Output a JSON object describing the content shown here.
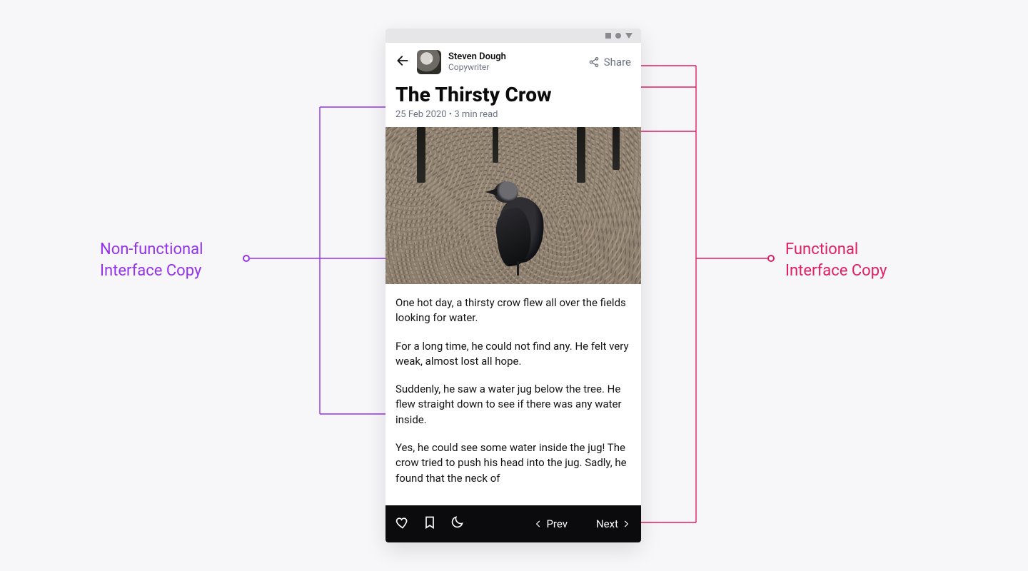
{
  "annotations": {
    "left": {
      "line1": "Non-functional",
      "line2": "Interface Copy"
    },
    "right": {
      "line1": "Functional",
      "line2": "Interface Copy"
    }
  },
  "header": {
    "author_name": "Steven Dough",
    "author_role": "Copywriter",
    "share_label": "Share"
  },
  "article": {
    "title": "The Thirsty Crow",
    "date": "25 Feb 2020",
    "read_time": "3 min read",
    "meta_separator": " • ",
    "paragraphs": [
      "One hot day, a thirsty crow flew all over the fields looking for water.",
      "For a long time, he could not find any. He felt very weak, almost lost all hope.",
      "Suddenly, he saw a water jug below the tree. He flew straight down to see if there was any water inside.",
      "Yes, he could see some water inside the jug! The crow tried to push his head into the jug. Sadly, he found that the neck of"
    ]
  },
  "toolbar": {
    "prev_label": "Prev",
    "next_label": "Next"
  }
}
